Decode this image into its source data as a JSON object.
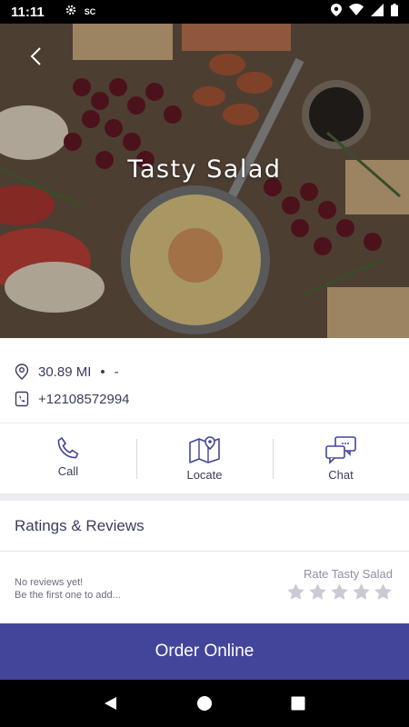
{
  "status_bar": {
    "time": "11:11",
    "gear_icon": "gear-icon",
    "sim_label": "SC",
    "icons": [
      "location-icon",
      "wifi-icon",
      "signal-icon",
      "battery-icon"
    ]
  },
  "hero": {
    "title": "Tasty Salad",
    "back_icon": "chevron-left-icon"
  },
  "info": {
    "distance": "30.89 MI",
    "bullet": "•",
    "extra": "-",
    "phone": "+12108572994"
  },
  "actions": [
    {
      "label": "Call",
      "icon": "phone-icon"
    },
    {
      "label": "Locate",
      "icon": "map-icon"
    },
    {
      "label": "Chat",
      "icon": "chat-icon"
    }
  ],
  "ratings": {
    "header": "Ratings & Reviews",
    "empty_line1": "No reviews yet!",
    "empty_line2": "Be the first one to add...",
    "rate_label": "Rate Tasty Salad",
    "current_rating": 0,
    "max_rating": 5
  },
  "order_button": "Order Online",
  "colors": {
    "accent": "#43459b",
    "text": "#3a3d5c",
    "star_empty": "#c9cad3"
  },
  "nav": [
    "back-icon",
    "home-icon",
    "recents-icon"
  ]
}
